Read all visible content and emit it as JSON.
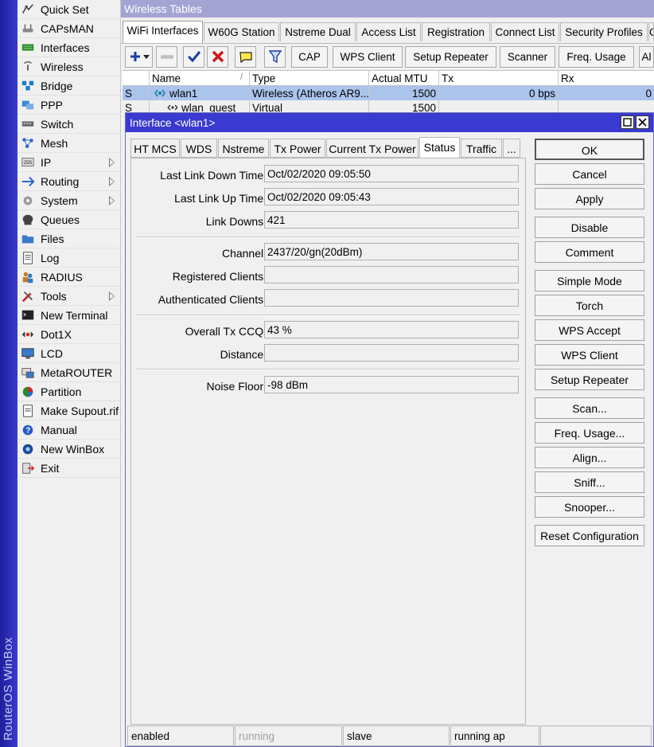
{
  "brand": "RouterOS WinBox",
  "sidebar": {
    "items": [
      {
        "label": "Quick Set",
        "icon": "quick-set-icon"
      },
      {
        "label": "CAPsMAN",
        "icon": "capsman-icon"
      },
      {
        "label": "Interfaces",
        "icon": "interfaces-icon"
      },
      {
        "label": "Wireless",
        "icon": "wireless-icon"
      },
      {
        "label": "Bridge",
        "icon": "bridge-icon"
      },
      {
        "label": "PPP",
        "icon": "ppp-icon"
      },
      {
        "label": "Switch",
        "icon": "switch-icon"
      },
      {
        "label": "Mesh",
        "icon": "mesh-icon"
      },
      {
        "label": "IP",
        "icon": "ip-icon",
        "submenu": true
      },
      {
        "label": "Routing",
        "icon": "routing-icon",
        "submenu": true
      },
      {
        "label": "System",
        "icon": "system-icon",
        "submenu": true
      },
      {
        "label": "Queues",
        "icon": "queues-icon"
      },
      {
        "label": "Files",
        "icon": "files-icon"
      },
      {
        "label": "Log",
        "icon": "log-icon"
      },
      {
        "label": "RADIUS",
        "icon": "radius-icon"
      },
      {
        "label": "Tools",
        "icon": "tools-icon",
        "submenu": true
      },
      {
        "label": "New Terminal",
        "icon": "terminal-icon"
      },
      {
        "label": "Dot1X",
        "icon": "dot1x-icon"
      },
      {
        "label": "LCD",
        "icon": "lcd-icon"
      },
      {
        "label": "MetaROUTER",
        "icon": "metarouter-icon"
      },
      {
        "label": "Partition",
        "icon": "partition-icon"
      },
      {
        "label": "Make Supout.rif",
        "icon": "supout-icon"
      },
      {
        "label": "Manual",
        "icon": "manual-icon"
      },
      {
        "label": "New WinBox",
        "icon": "winbox-icon"
      },
      {
        "label": "Exit",
        "icon": "exit-icon"
      }
    ]
  },
  "wireless_tables": {
    "title": "Wireless Tables",
    "tabs": [
      "WiFi Interfaces",
      "W60G Station",
      "Nstreme Dual",
      "Access List",
      "Registration",
      "Connect List",
      "Security Profiles",
      "C"
    ],
    "toolbar": {
      "buttons": [
        "CAP",
        "WPS Client",
        "Setup Repeater",
        "Scanner",
        "Freq. Usage",
        "Al"
      ]
    },
    "columns": [
      "",
      "Name",
      "Type",
      "Actual MTU",
      "Tx",
      "Rx"
    ],
    "rows": [
      {
        "flag": "S",
        "name": "wlan1",
        "type": "Wireless (Atheros AR9...",
        "mtu": "1500",
        "tx": "0 bps",
        "rx": "0"
      },
      {
        "flag": "S",
        "name": "wlan_guest",
        "type": "Virtual",
        "mtu": "1500",
        "tx": "",
        "rx": ""
      }
    ]
  },
  "dialog": {
    "title": "Interface <wlan1>",
    "tabs": [
      "HT MCS",
      "WDS",
      "Nstreme",
      "Tx Power",
      "Current Tx Power",
      "Status",
      "Traffic",
      "..."
    ],
    "active_tab": "Status",
    "fields": {
      "last_link_down_label": "Last Link Down Time:",
      "last_link_down_value": "Oct/02/2020 09:05:50",
      "last_link_up_label": "Last Link Up Time:",
      "last_link_up_value": "Oct/02/2020 09:05:43",
      "link_downs_label": "Link Downs:",
      "link_downs_value": "421",
      "channel_label": "Channel:",
      "channel_value": "2437/20/gn(20dBm)",
      "registered_clients_label": "Registered Clients:",
      "registered_clients_value": "",
      "authenticated_clients_label": "Authenticated Clients:",
      "authenticated_clients_value": "",
      "overall_tx_ccq_label": "Overall Tx CCQ:",
      "overall_tx_ccq_value": "43 %",
      "distance_label": "Distance:",
      "distance_value": "",
      "noise_floor_label": "Noise Floor:",
      "noise_floor_value": "-98 dBm"
    },
    "buttons": {
      "ok": "OK",
      "cancel": "Cancel",
      "apply": "Apply",
      "disable": "Disable",
      "comment": "Comment",
      "simple_mode": "Simple Mode",
      "torch": "Torch",
      "wps_accept": "WPS Accept",
      "wps_client": "WPS Client",
      "setup_repeater": "Setup Repeater",
      "scan": "Scan...",
      "freq_usage": "Freq. Usage...",
      "align": "Align...",
      "sniff": "Sniff...",
      "snooper": "Snooper...",
      "reset_configuration": "Reset Configuration"
    },
    "status_bar": [
      "enabled",
      "running",
      "slave",
      "running ap",
      ""
    ]
  },
  "colors": {
    "title_active": "#3a3ad0",
    "title_inactive": "#a4a4d4",
    "selected_row": "#aac4ec",
    "brand_bar": "#2a2ab8"
  }
}
